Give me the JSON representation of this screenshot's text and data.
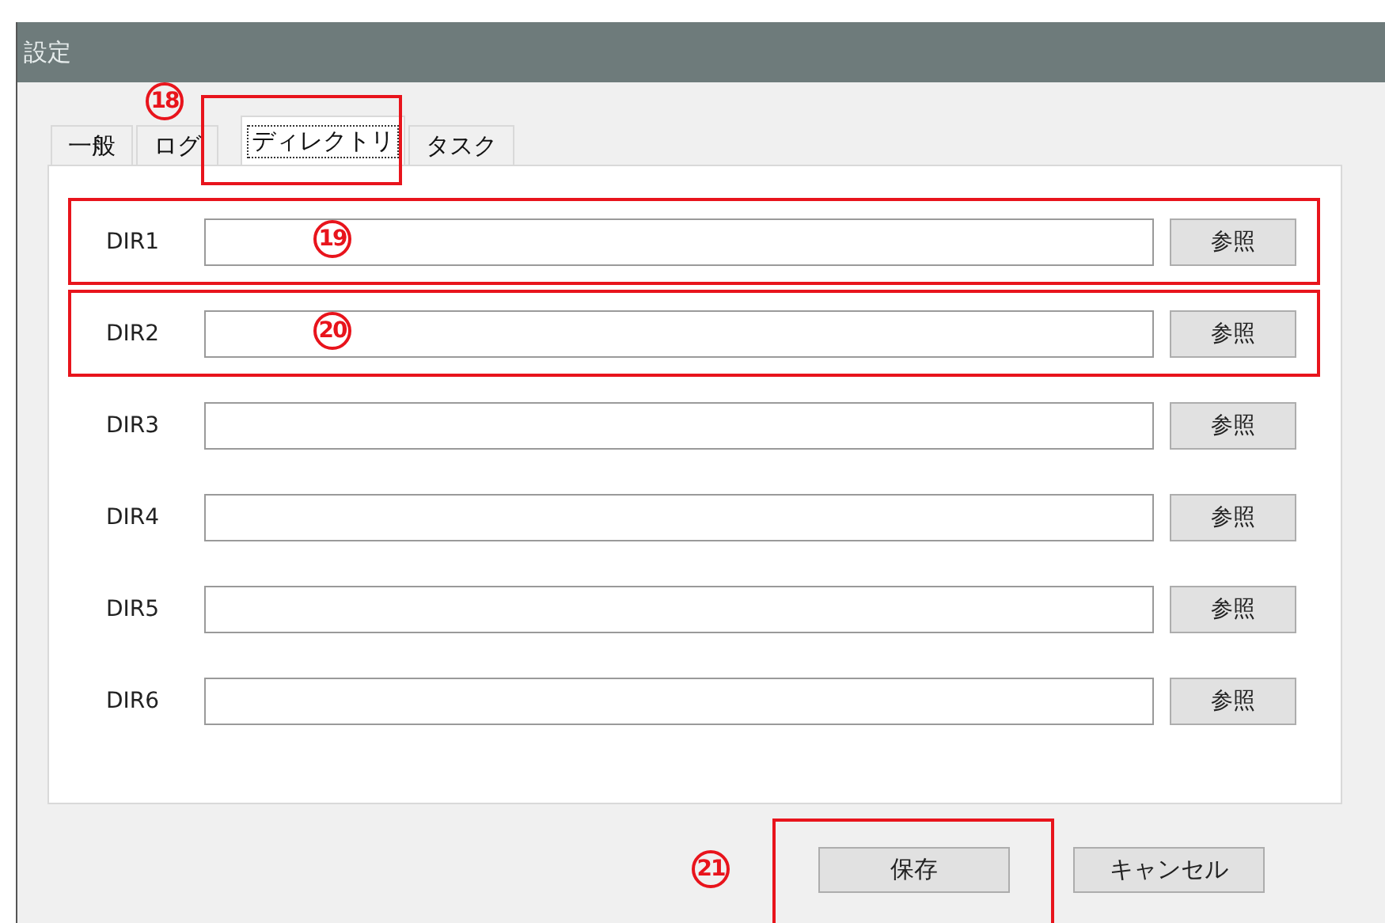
{
  "window": {
    "title": "設定"
  },
  "tabs": [
    {
      "label": "一般",
      "selected": false
    },
    {
      "label": "ログ",
      "selected": false
    },
    {
      "label": "ディレクトリ",
      "selected": true,
      "highlighted": true,
      "callout": "18"
    },
    {
      "label": "タスク",
      "selected": false
    }
  ],
  "directories": [
    {
      "label": "DIR1",
      "button": "参照",
      "highlighted": true,
      "callout": "19"
    },
    {
      "label": "DIR2",
      "button": "参照",
      "highlighted": true,
      "callout": "20"
    },
    {
      "label": "DIR3",
      "button": "参照"
    },
    {
      "label": "DIR4",
      "button": "参照"
    },
    {
      "label": "DIR5",
      "button": "参照"
    },
    {
      "label": "DIR6",
      "button": "参照"
    }
  ],
  "buttons": [
    {
      "label": "保存",
      "highlighted": true,
      "callout": "21"
    },
    {
      "label": "キャンセル"
    }
  ]
}
